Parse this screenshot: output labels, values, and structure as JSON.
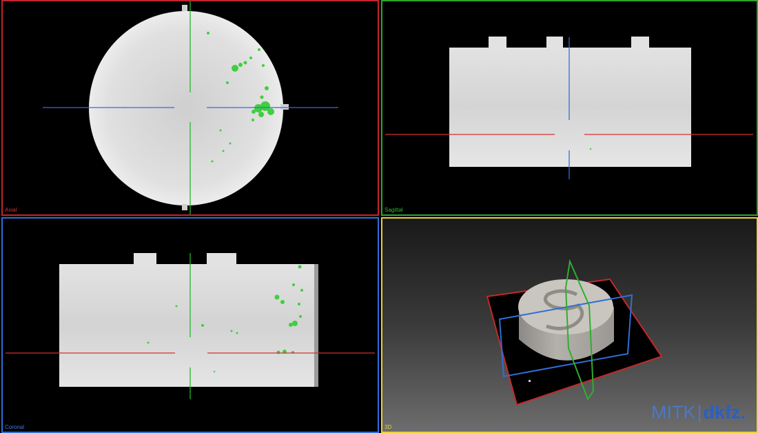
{
  "views": {
    "axial": {
      "label": "Axial",
      "border_color": "#c0262d"
    },
    "sagittal": {
      "label": "Sagittal",
      "border_color": "#2fa62c"
    },
    "coronal": {
      "label": "Coronal",
      "border_color": "#2e6fd6"
    },
    "three_d": {
      "label": "3D",
      "border_color": "#e6d43a"
    }
  },
  "brand": {
    "mitk": "MITK",
    "separator": "|",
    "dkfz": "dkfz."
  },
  "colors": {
    "crosshair_red": "#d32f2f",
    "crosshair_green": "#25b52a",
    "crosshair_blue": "#2d6fe0",
    "phantom_gray": "#d9d9d9",
    "highlight_green": "#3bd13b"
  }
}
